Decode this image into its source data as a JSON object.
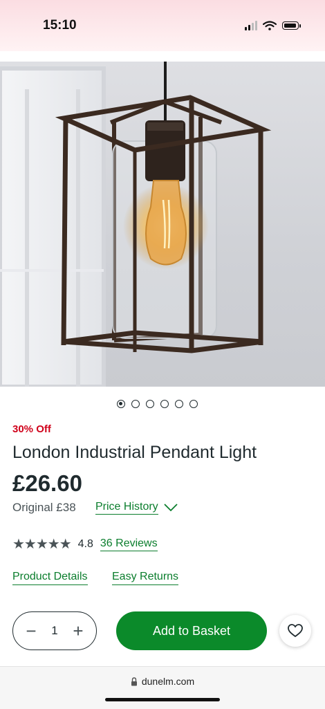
{
  "status": {
    "time": "15:10"
  },
  "product": {
    "discount": "30% Off",
    "title": "London Industrial Pendant Light",
    "price": "£26.60",
    "original_price": "Original £38",
    "price_history_label": "Price History",
    "rating": {
      "stars": "★★★★★",
      "value": "4.8",
      "reviews": "36 Reviews"
    },
    "links": {
      "details": "Product Details",
      "returns": "Easy Returns"
    }
  },
  "carousel": {
    "count": 6,
    "active_index": 0
  },
  "basket": {
    "quantity": "1",
    "minus": "−",
    "plus": "+",
    "add_label": "Add to Basket"
  },
  "browser": {
    "url": "dunelm.com"
  },
  "icons": {
    "signal": "signal-icon",
    "wifi": "wifi-icon",
    "battery": "battery-icon",
    "chevron": "chevron-down-icon",
    "heart": "heart-icon",
    "lock": "lock-icon"
  },
  "colors": {
    "accent": "#0b8a2a",
    "link": "#0a7d2c",
    "discount": "#d0021b",
    "text": "#1f2a2e"
  }
}
